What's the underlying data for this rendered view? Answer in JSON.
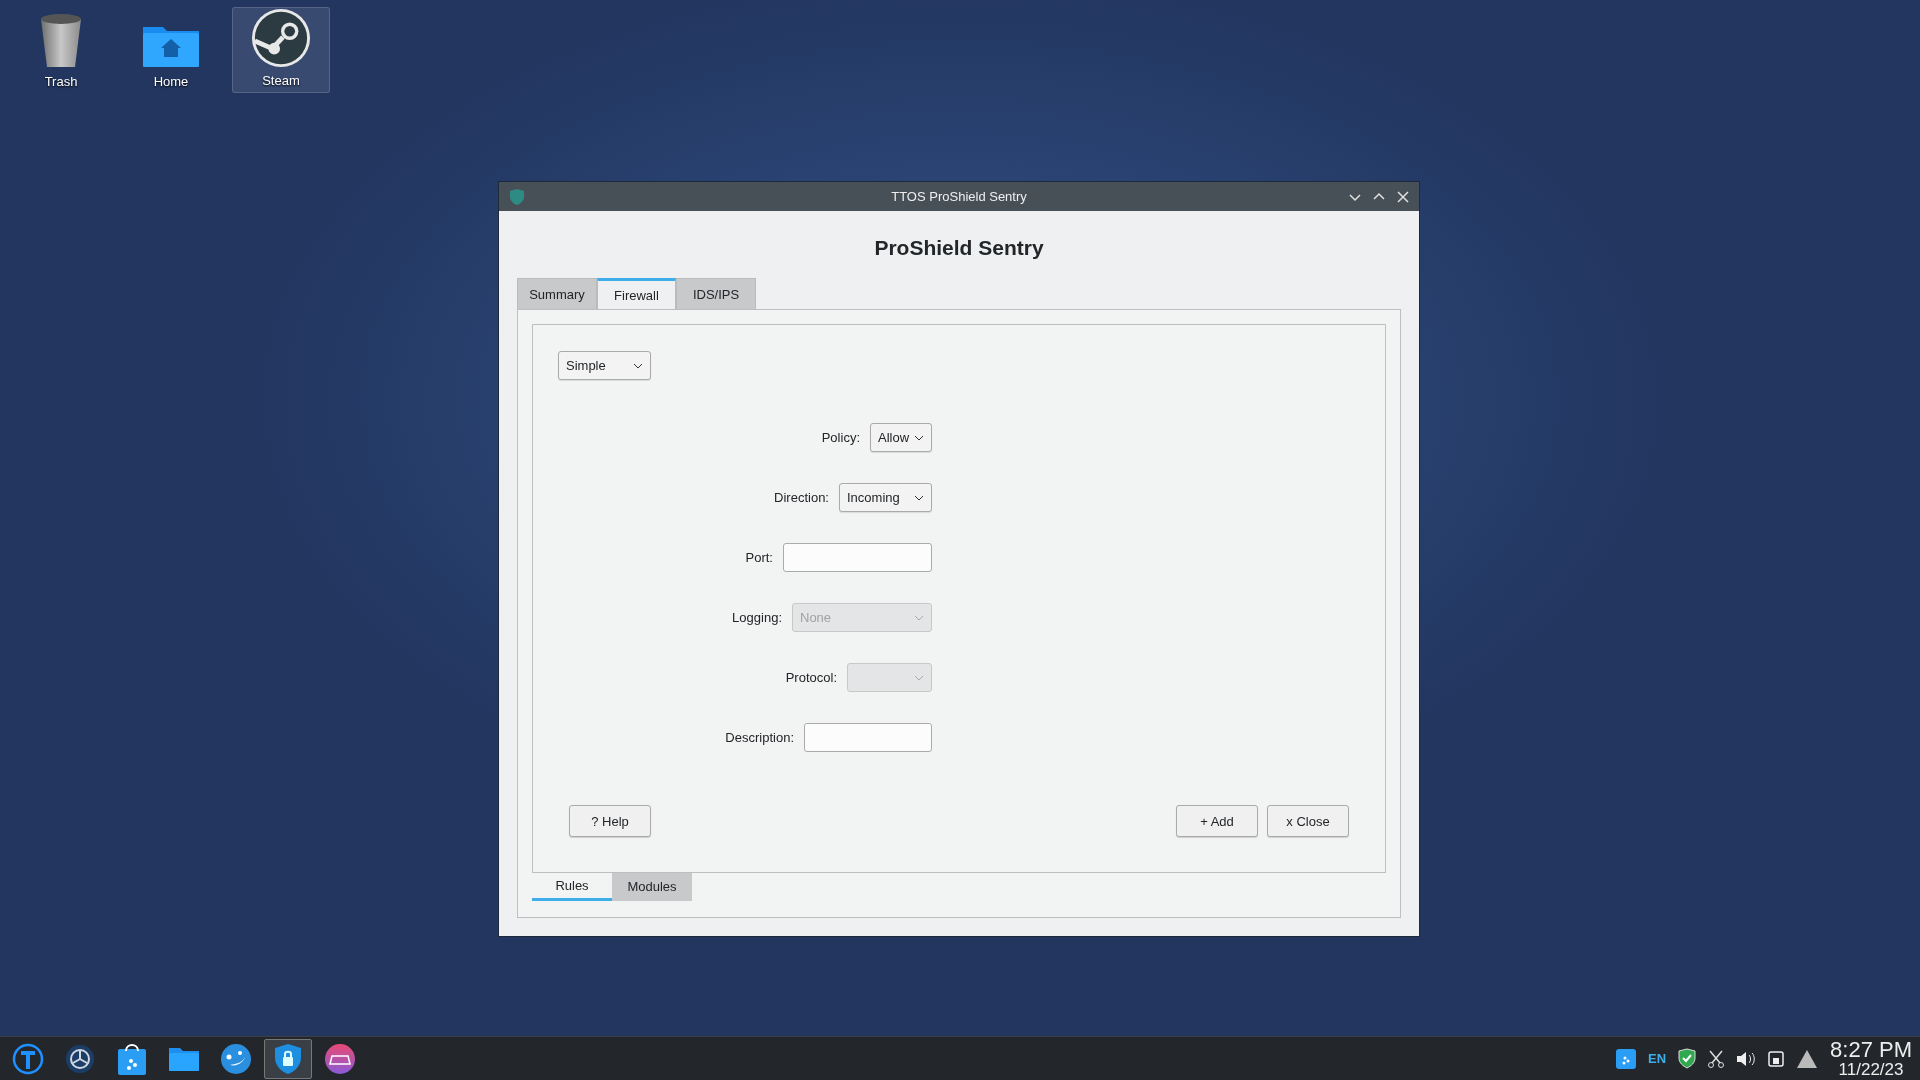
{
  "desktop_icons": [
    {
      "label": "Trash",
      "kind": "trash",
      "selected": false
    },
    {
      "label": "Home",
      "kind": "folder",
      "selected": false
    },
    {
      "label": "Steam",
      "kind": "steam",
      "selected": true
    }
  ],
  "window": {
    "title": "TTOS ProShield Sentry",
    "heading": "ProShield Sentry",
    "tabs": [
      {
        "label": "Summary",
        "selected": false
      },
      {
        "label": "Firewall",
        "selected": true
      },
      {
        "label": "IDS/IPS",
        "selected": false
      }
    ],
    "mode": {
      "value": "Simple"
    },
    "form": [
      {
        "label": "Policy:",
        "kind": "select",
        "value": "Allow",
        "disabled": false
      },
      {
        "label": "Direction:",
        "kind": "select",
        "value": "Incoming",
        "disabled": false
      },
      {
        "label": "Port:",
        "kind": "text",
        "disabled": false
      },
      {
        "label": "Logging:",
        "kind": "select",
        "value": "None",
        "disabled": true
      },
      {
        "label": "Protocol:",
        "kind": "select",
        "disabled": true
      },
      {
        "label": "Description:",
        "kind": "text",
        "disabled": false
      }
    ],
    "help_button": "? Help",
    "action_buttons": [
      "+ Add",
      "x Close"
    ],
    "bottom_tabs": [
      {
        "label": "Rules",
        "selected": true
      },
      {
        "label": "Modules",
        "selected": false
      }
    ]
  },
  "taskbar": {
    "apps": [
      {
        "kind": "launcher",
        "active": false
      },
      {
        "kind": "settings",
        "active": false
      },
      {
        "kind": "store",
        "active": false
      },
      {
        "kind": "files",
        "active": false
      },
      {
        "kind": "chat",
        "active": false
      },
      {
        "kind": "shield",
        "active": true
      },
      {
        "kind": "game",
        "active": false
      }
    ],
    "language": "EN",
    "time": "8:27 PM",
    "date": "11/22/23"
  }
}
